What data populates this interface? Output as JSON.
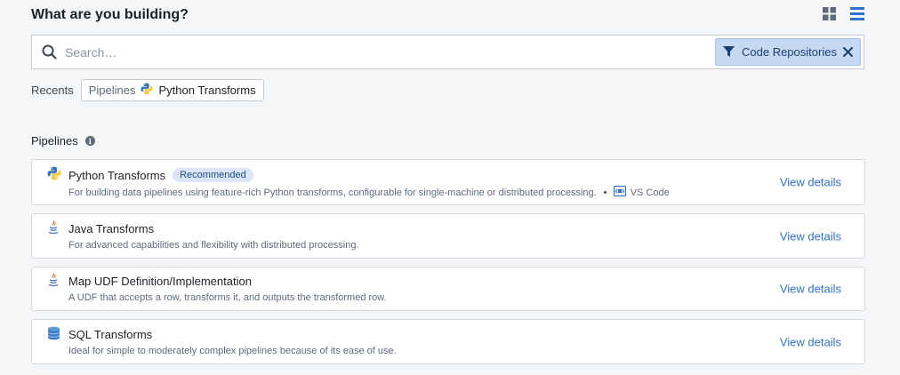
{
  "header": {
    "title": "What are you building?",
    "grid_view_icon": "grid-view-icon",
    "list_view_icon": "list-view-icon"
  },
  "search": {
    "placeholder": "Search…",
    "value": "",
    "filter": {
      "label": "Code Repositories",
      "icon": "funnel-icon"
    }
  },
  "recents": {
    "label": "Recents",
    "chip": {
      "category": "Pipelines",
      "item": "Python Transforms"
    }
  },
  "section": {
    "title": "Pipelines",
    "info_icon_text": "i"
  },
  "cards": [
    {
      "icon": "python-icon",
      "title": "Python Transforms",
      "badge": "Recommended",
      "description": "For building data pipelines using feature-rich Python transforms, configurable for single-machine or distributed processing.",
      "tool": "VS Code",
      "link": "View details"
    },
    {
      "icon": "java-icon",
      "title": "Java Transforms",
      "description": "For advanced capabilities and flexibility with distributed processing.",
      "link": "View details"
    },
    {
      "icon": "java-icon",
      "title": "Map UDF Definition/Implementation",
      "description": "A UDF that accepts a row, transforms it, and outputs the transformed row.",
      "link": "View details"
    },
    {
      "icon": "database-icon",
      "title": "SQL Transforms",
      "description": "Ideal for simple to moderately complex pipelines because of its ease of use.",
      "link": "View details"
    }
  ],
  "colors": {
    "accent": "#2d72d2",
    "filter_bg": "#c6d9f3",
    "badge_bg": "#dbe6f6"
  }
}
